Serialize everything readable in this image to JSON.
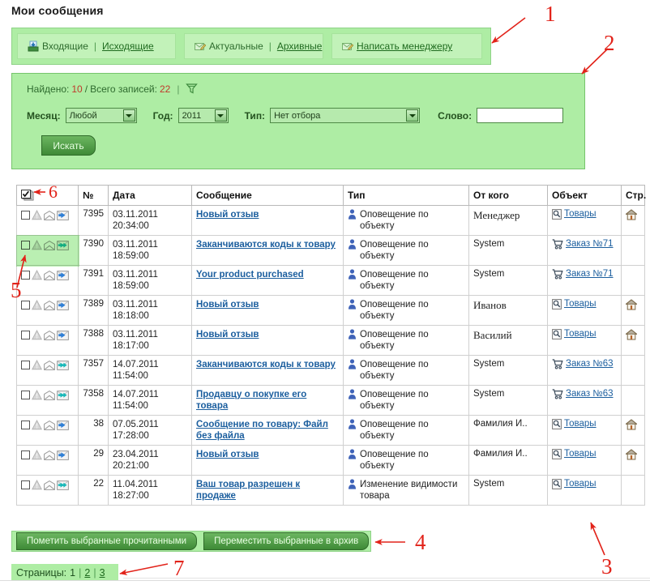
{
  "page": {
    "title": "Мои сообщения"
  },
  "tabs": {
    "groups": [
      {
        "icon": "inbox-icon",
        "text": "Входящие",
        "sep": "|",
        "link": "Исходящие"
      },
      {
        "icon": "compose-icon",
        "text": "Актуальные",
        "sep": "|",
        "link": "Архивные"
      },
      {
        "icon": "compose-icon",
        "text": "",
        "sep": "",
        "link": "Написать менеджеру"
      }
    ]
  },
  "filter": {
    "found_label": "Найдено:",
    "found_value": "10",
    "slash": "/",
    "total_label": "Всего записей:",
    "total_value": "22",
    "divider": "|",
    "funnel_icon": "filter-funnel-icon",
    "month_label": "Месяц:",
    "month_value": "Любой",
    "year_label": "Год:",
    "year_value": "2011",
    "type_label": "Тип:",
    "type_value": "Нет отбора",
    "word_label": "Слово:",
    "word_value": "",
    "search_button": "Искать"
  },
  "table": {
    "headers": [
      "",
      "№",
      "Дата",
      "Сообщение",
      "Тип",
      "От кого",
      "Объект",
      "Стр."
    ],
    "header_checkbox_icon": "select-all-checkbox-icon",
    "rows": [
      {
        "num": "7395",
        "date": "03.11.2011",
        "time": "20:34:00",
        "message": "Новый отзыв",
        "type": "Оповещение по объекту",
        "from": "Менеджер",
        "from_style": "serif",
        "object": "Товары",
        "object_icon": "product-doc-icon",
        "page_icon": "home-icon",
        "reply_state": "replied-blue",
        "selected": false
      },
      {
        "num": "7390",
        "date": "03.11.2011",
        "time": "18:59:00",
        "message": "Заканчиваются коды к товару",
        "type": "Оповещение по объекту",
        "from": "System",
        "from_style": "sans",
        "object": "Заказ №71",
        "object_icon": "cart-icon",
        "page_icon": "",
        "reply_state": "replied-teal",
        "selected": true
      },
      {
        "num": "7391",
        "date": "03.11.2011",
        "time": "18:59:00",
        "message": "Your product purchased",
        "type": "Оповещение по объекту",
        "from": "System",
        "from_style": "sans",
        "object": "Заказ №71",
        "object_icon": "cart-icon",
        "page_icon": "",
        "reply_state": "replied-blue",
        "selected": false
      },
      {
        "num": "7389",
        "date": "03.11.2011",
        "time": "18:18:00",
        "message": "Новый отзыв",
        "type": "Оповещение по объекту",
        "from": "Иванов",
        "from_style": "serif",
        "object": "Товары",
        "object_icon": "product-doc-icon",
        "page_icon": "home-icon",
        "reply_state": "replied-blue",
        "selected": false
      },
      {
        "num": "7388",
        "date": "03.11.2011",
        "time": "18:17:00",
        "message": "Новый отзыв",
        "type": "Оповещение по объекту",
        "from": "Василий",
        "from_style": "serif",
        "object": "Товары",
        "object_icon": "product-doc-icon",
        "page_icon": "home-icon",
        "reply_state": "replied-blue",
        "selected": false
      },
      {
        "num": "7357",
        "date": "14.07.2011",
        "time": "11:54:00",
        "message": "Заканчиваются коды к товару",
        "type": "Оповещение по объекту",
        "from": "System",
        "from_style": "sans",
        "object": "Заказ №63",
        "object_icon": "cart-icon",
        "page_icon": "",
        "reply_state": "replied-teal",
        "selected": false
      },
      {
        "num": "7358",
        "date": "14.07.2011",
        "time": "11:54:00",
        "message": "Продавцу о покупке его товара",
        "type": "Оповещение по объекту",
        "from": "System",
        "from_style": "sans",
        "object": "Заказ №63",
        "object_icon": "cart-icon",
        "page_icon": "",
        "reply_state": "replied-teal",
        "selected": false
      },
      {
        "num": "38",
        "date": "07.05.2011",
        "time": "17:28:00",
        "message": "Сообщение по товару: Файл без файла",
        "type": "Оповещение по объекту",
        "from": "Фамилия И..",
        "from_style": "sans",
        "object": "Товары",
        "object_icon": "product-doc-icon",
        "page_icon": "home-icon",
        "reply_state": "replied-blue",
        "selected": false
      },
      {
        "num": "29",
        "date": "23.04.2011",
        "time": "20:21:00",
        "message": "Новый отзыв",
        "type": "Оповещение по объекту",
        "from": "Фамилия И..",
        "from_style": "sans",
        "object": "Товары",
        "object_icon": "product-doc-icon",
        "page_icon": "home-icon",
        "reply_state": "replied-blue",
        "selected": false
      },
      {
        "num": "22",
        "date": "11.04.2011",
        "time": "18:27:00",
        "message": "Ваш товар разрешен к продаже",
        "type": "Изменение видимости товара",
        "from": "System",
        "from_style": "sans",
        "object": "Товары",
        "object_icon": "product-doc-icon",
        "page_icon": "",
        "reply_state": "replied-teal",
        "selected": false
      }
    ]
  },
  "actions": {
    "mark_read": "Пометить выбранные прочитанными",
    "move_archive": "Переместить выбранные в архив"
  },
  "pagination": {
    "label": "Страницы:",
    "current": "1",
    "bar1": "|",
    "page2": "2",
    "bar2": "|",
    "page3": "3"
  },
  "annotations": {
    "markers": [
      "1",
      "2",
      "3",
      "4",
      "5",
      "6",
      "7"
    ]
  },
  "colors": {
    "panel_green": "#aeeda4",
    "tab_inner_green": "#c2f2b9",
    "link_blue": "#1b5e9e",
    "link_green": "#1f6b1f",
    "count_red": "#c0392b",
    "annotation_red": "#e2231a"
  }
}
